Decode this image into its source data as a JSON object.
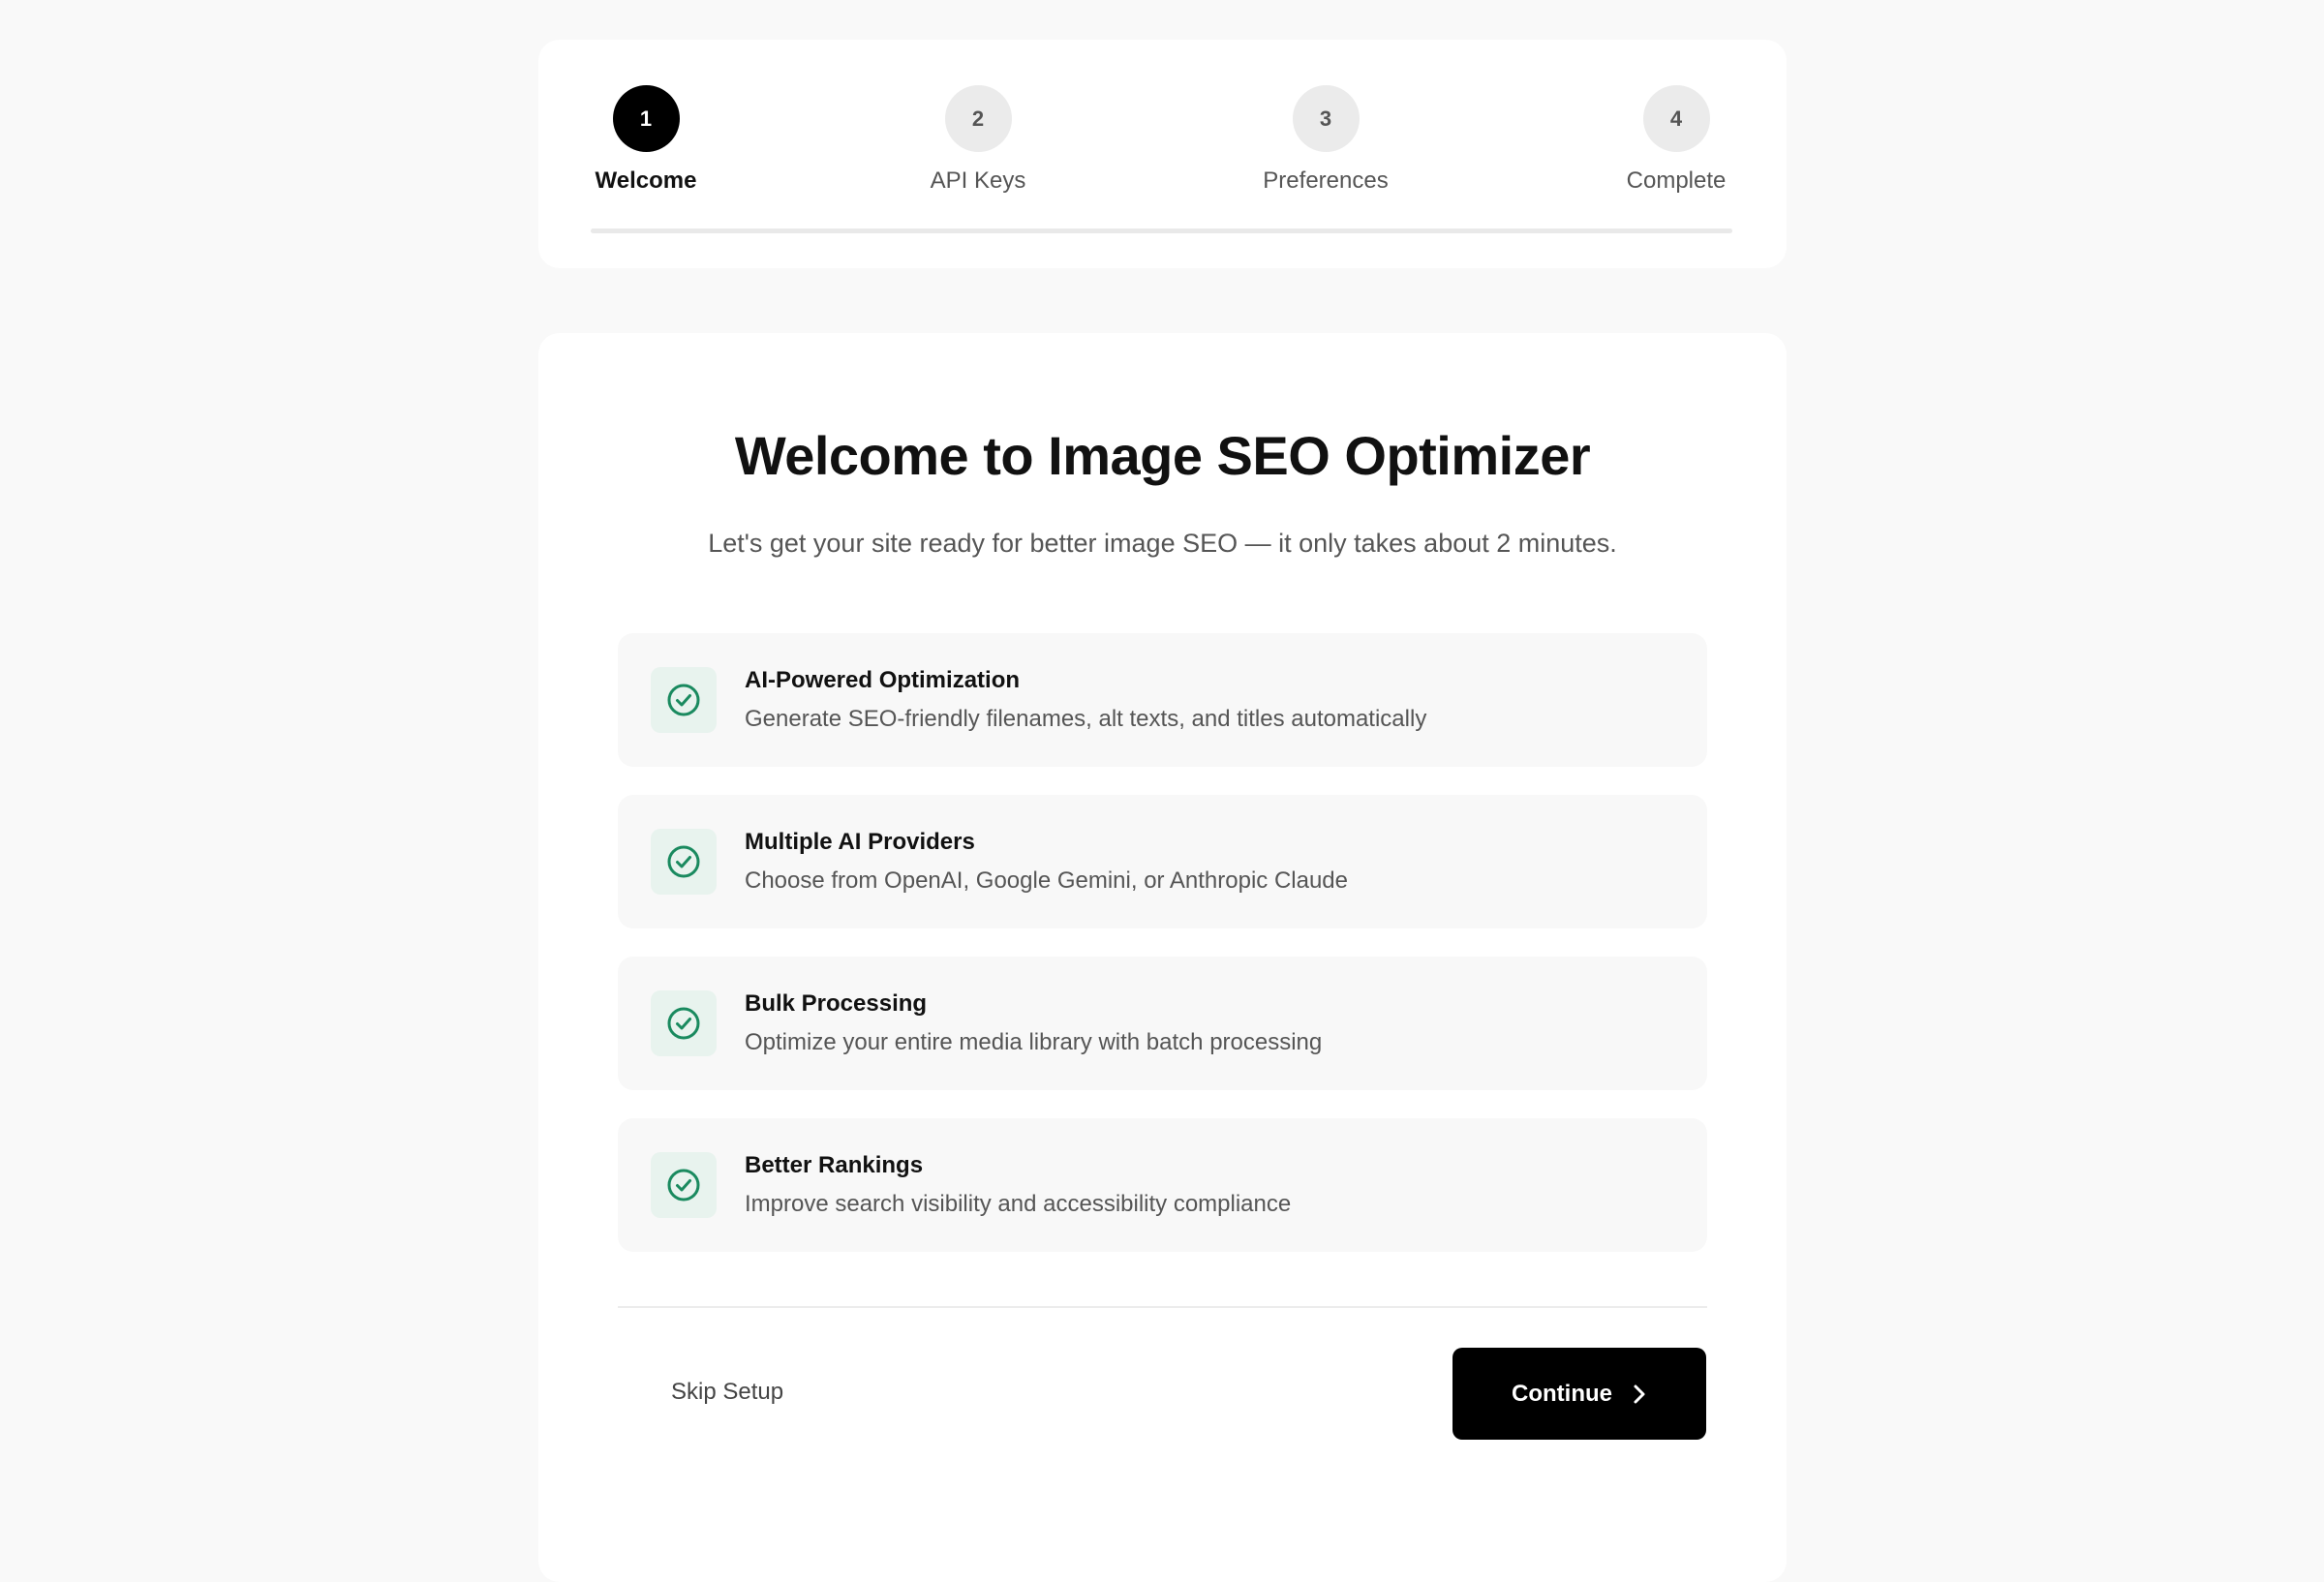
{
  "stepper": {
    "steps": [
      {
        "number": "1",
        "label": "Welcome",
        "state": "active"
      },
      {
        "number": "2",
        "label": "API Keys",
        "state": "pending"
      },
      {
        "number": "3",
        "label": "Preferences",
        "state": "pending"
      },
      {
        "number": "4",
        "label": "Complete",
        "state": "pending"
      }
    ]
  },
  "welcome": {
    "title": "Welcome to Image SEO Optimizer",
    "subtitle": "Let's get your site ready for better image SEO — it only takes about 2 minutes."
  },
  "features": [
    {
      "icon": "check-circle-icon",
      "title": "AI-Powered Optimization",
      "description": "Generate SEO-friendly filenames, alt texts, and titles automatically"
    },
    {
      "icon": "check-circle-icon",
      "title": "Multiple AI Providers",
      "description": "Choose from OpenAI, Google Gemini, or Anthropic Claude"
    },
    {
      "icon": "check-circle-icon",
      "title": "Bulk Processing",
      "description": "Optimize your entire media library with batch processing"
    },
    {
      "icon": "check-circle-icon",
      "title": "Better Rankings",
      "description": "Improve search visibility and accessibility compliance"
    }
  ],
  "actions": {
    "skip_label": "Skip Setup",
    "continue_label": "Continue",
    "continue_icon": "chevron-right-icon"
  },
  "colors": {
    "accent": "#000000",
    "success": "#1a8a5f",
    "background": "#f9f9f9"
  }
}
